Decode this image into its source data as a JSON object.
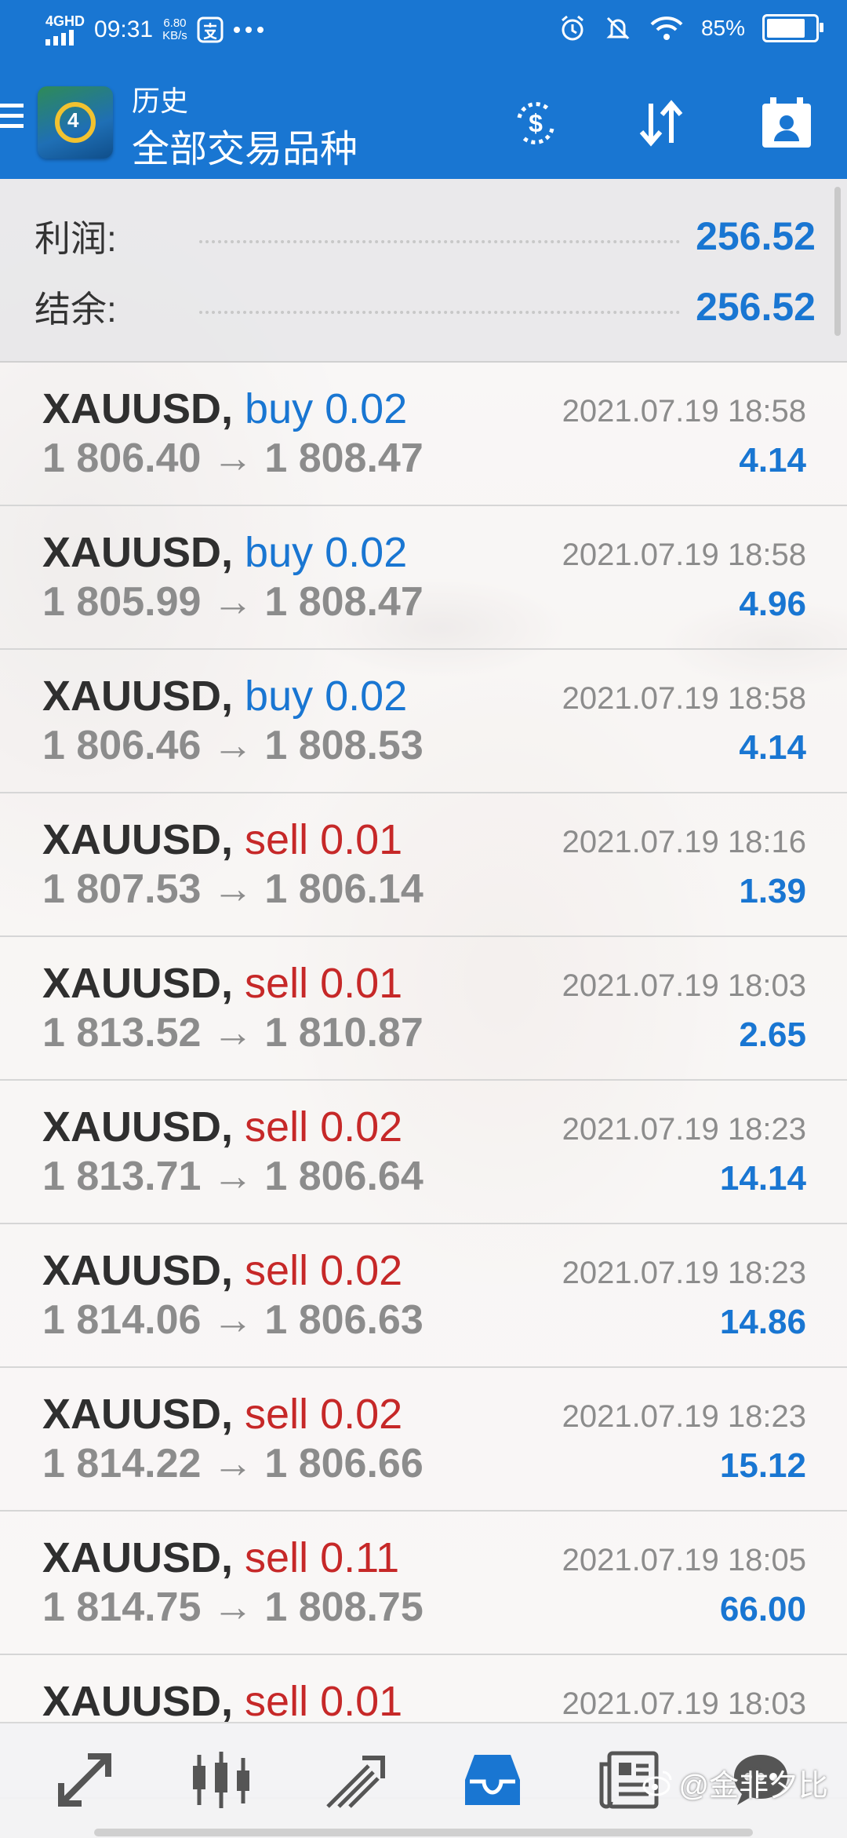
{
  "status_bar": {
    "network": "4GHD",
    "time": "09:31",
    "net_speed": "6.80",
    "net_speed_unit": "KB/s",
    "battery": "85%"
  },
  "app_bar": {
    "title": "历史",
    "subtitle": "全部交易品种"
  },
  "summary": {
    "profit_label": "利润:",
    "profit_value": "256.52",
    "balance_label": "结余:",
    "balance_value": "256.52"
  },
  "trades": [
    {
      "symbol": "XAUUSD,",
      "side": "buy",
      "volume": "0.02",
      "open": "1 806.40",
      "close": "1 808.47",
      "time": "2021.07.19 18:58",
      "profit": "4.14"
    },
    {
      "symbol": "XAUUSD,",
      "side": "buy",
      "volume": "0.02",
      "open": "1 805.99",
      "close": "1 808.47",
      "time": "2021.07.19 18:58",
      "profit": "4.96"
    },
    {
      "symbol": "XAUUSD,",
      "side": "buy",
      "volume": "0.02",
      "open": "1 806.46",
      "close": "1 808.53",
      "time": "2021.07.19 18:58",
      "profit": "4.14"
    },
    {
      "symbol": "XAUUSD,",
      "side": "sell",
      "volume": "0.01",
      "open": "1 807.53",
      "close": "1 806.14",
      "time": "2021.07.19 18:16",
      "profit": "1.39"
    },
    {
      "symbol": "XAUUSD,",
      "side": "sell",
      "volume": "0.01",
      "open": "1 813.52",
      "close": "1 810.87",
      "time": "2021.07.19 18:03",
      "profit": "2.65"
    },
    {
      "symbol": "XAUUSD,",
      "side": "sell",
      "volume": "0.02",
      "open": "1 813.71",
      "close": "1 806.64",
      "time": "2021.07.19 18:23",
      "profit": "14.14"
    },
    {
      "symbol": "XAUUSD,",
      "side": "sell",
      "volume": "0.02",
      "open": "1 814.06",
      "close": "1 806.63",
      "time": "2021.07.19 18:23",
      "profit": "14.86"
    },
    {
      "symbol": "XAUUSD,",
      "side": "sell",
      "volume": "0.02",
      "open": "1 814.22",
      "close": "1 806.66",
      "time": "2021.07.19 18:23",
      "profit": "15.12"
    },
    {
      "symbol": "XAUUSD,",
      "side": "sell",
      "volume": "0.11",
      "open": "1 814.75",
      "close": "1 808.75",
      "time": "2021.07.19 18:05",
      "profit": "66.00"
    },
    {
      "symbol": "XAUUSD,",
      "side": "sell",
      "volume": "0.01",
      "open": "",
      "close": "",
      "time": "2021.07.19 18:03",
      "profit": ""
    }
  ],
  "arrow_glyph": "→",
  "bottom_nav": {
    "items": [
      "quotes-icon",
      "chart-candles-icon",
      "trade-icon",
      "history-icon",
      "news-icon",
      "chat-icon"
    ],
    "active": "history-icon"
  },
  "watermark": "@金非夕比",
  "colors": {
    "accent": "#1976d2",
    "sell": "#c62828",
    "price_gray": "#8c8c8c"
  }
}
